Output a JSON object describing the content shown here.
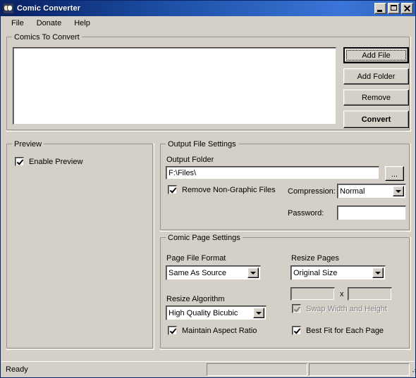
{
  "window": {
    "title": "Comic Converter",
    "icon": "theater-masks-icon",
    "buttons": {
      "minimize": "Minimize",
      "maximize": "Maximize",
      "close": "Close"
    }
  },
  "menu": {
    "items": [
      {
        "label": "File"
      },
      {
        "label": "Donate"
      },
      {
        "label": "Help"
      }
    ]
  },
  "comics_group": {
    "label": "Comics To Convert",
    "list_items": [],
    "buttons": {
      "add_file": "Add File",
      "add_folder": "Add Folder",
      "remove": "Remove",
      "convert": "Convert"
    }
  },
  "preview_group": {
    "label": "Preview",
    "enable_preview_label": "Enable Preview",
    "enable_preview_checked": true
  },
  "output_group": {
    "label": "Output File Settings",
    "output_folder_label": "Output Folder",
    "output_folder_value": "F:\\Files\\",
    "output_folder_placeholder": "",
    "browse_label": "...",
    "remove_non_graphic_label": "Remove Non-Graphic Files",
    "remove_non_graphic_checked": true,
    "compression_label": "Compression:",
    "compression_value": "Normal",
    "compression_options": [
      "Normal"
    ],
    "password_label": "Password:",
    "password_value": "",
    "password_placeholder": ""
  },
  "page_group": {
    "label": "Comic Page Settings",
    "page_file_format_label": "Page File Format",
    "page_file_format_value": "Same As Source",
    "page_file_format_options": [
      "Same As Source"
    ],
    "resize_pages_label": "Resize Pages",
    "resize_pages_value": "Original Size",
    "resize_pages_options": [
      "Original Size"
    ],
    "width_value": "",
    "height_value": "",
    "dimension_separator": "x",
    "swap_label": "Swap Width and Height",
    "swap_checked": true,
    "swap_enabled": false,
    "resize_algorithm_label": "Resize Algorithm",
    "resize_algorithm_value": "High Quality Bicubic",
    "resize_algorithm_options": [
      "High Quality Bicubic"
    ],
    "maintain_aspect_label": "Maintain Aspect Ratio",
    "maintain_aspect_checked": true,
    "best_fit_label": "Best Fit for Each Page",
    "best_fit_checked": true
  },
  "statusbar": {
    "message": "Ready",
    "pane2": "",
    "pane3": ""
  },
  "colors": {
    "face": "#d4d0c8",
    "title_start": "#0a246a",
    "title_end": "#3a75d8",
    "field": "#ffffff",
    "disabled_text": "#808080"
  }
}
